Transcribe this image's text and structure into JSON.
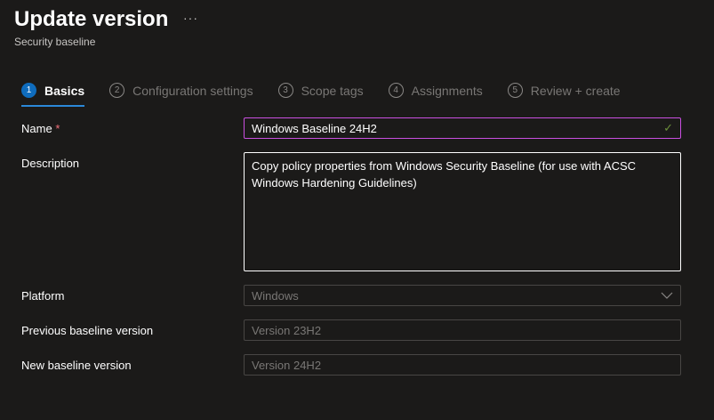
{
  "header": {
    "title": "Update version",
    "subtitle": "Security baseline",
    "more": "···"
  },
  "steps": [
    {
      "num": "1",
      "label": "Basics"
    },
    {
      "num": "2",
      "label": "Configuration settings"
    },
    {
      "num": "3",
      "label": "Scope tags"
    },
    {
      "num": "4",
      "label": "Assignments"
    },
    {
      "num": "5",
      "label": "Review + create"
    }
  ],
  "form": {
    "name_label": "Name",
    "required": "*",
    "name_value": "Windows Baseline 24H2",
    "description_label": "Description",
    "description_value": "Copy policy properties from Windows Security Baseline (for use with ACSC Windows Hardening Guidelines)",
    "platform_label": "Platform",
    "platform_value": "Windows",
    "prev_label": "Previous baseline version",
    "prev_value": "Version 23H2",
    "new_label": "New baseline version",
    "new_value": "Version 24H2"
  }
}
